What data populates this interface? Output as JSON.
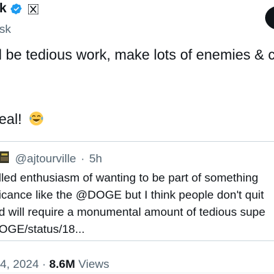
{
  "author": {
    "name_visible": "k",
    "handle_visible": "sk"
  },
  "icons": {
    "verified": "verified-badge-icon",
    "platform": "x-logo-icon",
    "emoji": "face-with-tears-of-joy-icon",
    "more": "more-options-icon"
  },
  "colors": {
    "verified": "#1d9bf0",
    "text": "#0f1419",
    "secondary": "#536471",
    "border": "#cfd9de"
  },
  "tweet": {
    "line1": "l be tedious work, make lots of enemies & co",
    "line2": "eal!"
  },
  "quote": {
    "handle": "@ajtourville",
    "separator": "·",
    "time": "5h",
    "lines": [
      "lled enthusiasm of wanting to be part of something",
      "icance like the @DOGE but I think people don't quit",
      "d will require a monumental amount of tedious supe",
      "OGE/status/18..."
    ]
  },
  "meta": {
    "date": "4, 2024",
    "separator": "·",
    "views_count": "8.6M",
    "views_label": "Views"
  }
}
